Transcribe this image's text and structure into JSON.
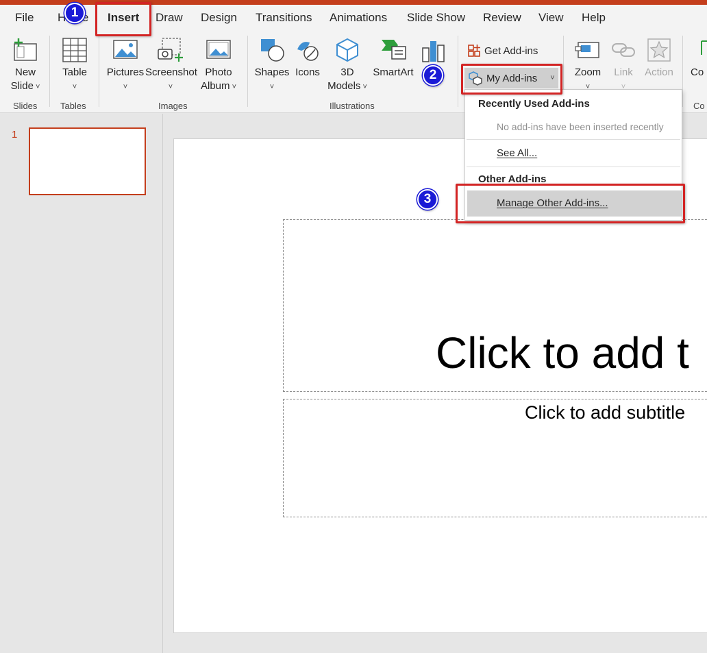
{
  "tabs": [
    "File",
    "Home",
    "Insert",
    "Draw",
    "Design",
    "Transitions",
    "Animations",
    "Slide Show",
    "Review",
    "View",
    "Help"
  ],
  "active_tab": "Insert",
  "ribbon": {
    "slides": {
      "new_slide_1": "New",
      "new_slide_2": "Slide",
      "group": "Slides"
    },
    "tables": {
      "table": "Table",
      "group": "Tables"
    },
    "images": {
      "pictures": "Pictures",
      "screenshot": "Screenshot",
      "photo_album_1": "Photo",
      "photo_album_2": "Album",
      "group": "Images"
    },
    "illustrations": {
      "shapes": "Shapes",
      "icons": "Icons",
      "models_1": "3D",
      "models_2": "Models",
      "smartart": "SmartArt",
      "chart_partial": "C",
      "group": "Illustrations"
    },
    "addins": {
      "get_addins": "Get Add-ins",
      "my_addins": "My Add-ins"
    },
    "links": {
      "zoom": "Zoom",
      "link": "Link",
      "action": "Action"
    },
    "comments": {
      "label_partial": "Co",
      "group_partial": "Co"
    }
  },
  "dropdown": {
    "recent_header": "Recently Used Add-ins",
    "recent_empty": "No add-ins have been inserted recently",
    "see_all": "See All...",
    "other_header": "Other Add-ins",
    "manage": "Manage Other Add-ins..."
  },
  "slide_panel": {
    "number": "1"
  },
  "slide": {
    "title_placeholder": "Click to add t",
    "subtitle_placeholder": "Click to add subtitle"
  },
  "badges": [
    "1",
    "2",
    "3"
  ],
  "colors": {
    "accent": "#c43e1c",
    "highlight": "#d32424",
    "badge": "#1a1ad6"
  }
}
